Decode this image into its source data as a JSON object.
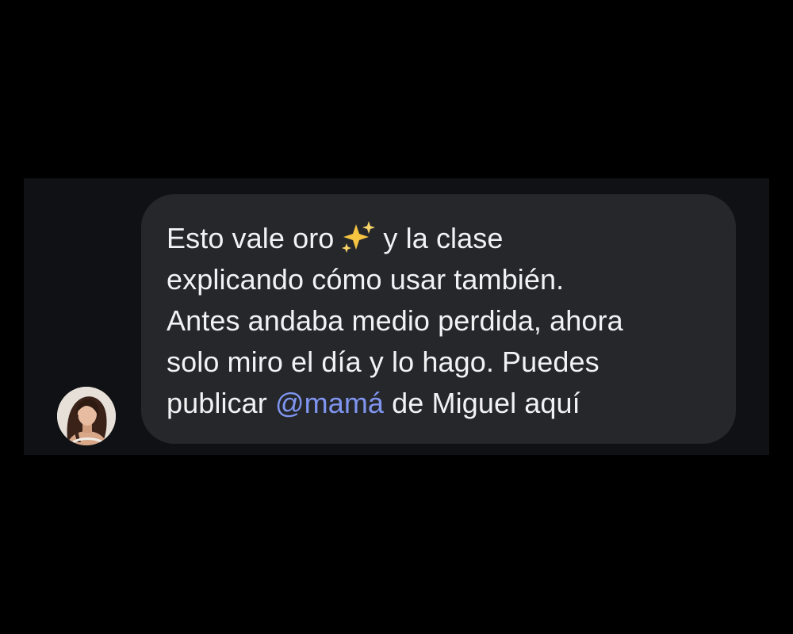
{
  "conversation": {
    "message": {
      "line1_before": "Esto vale oro",
      "emoji": "sparkles-icon",
      "line1_after": "y la clase",
      "line2": "explicando cómo usar también.",
      "line3": "Antes andaba medio perdida, ahora",
      "line4": "solo miro el día y lo hago. Puedes",
      "line5_before": "publicar",
      "mention": "@mamá",
      "line5_after": "de Miguel aquí"
    },
    "colors": {
      "background": "#000000",
      "strip": "#0f1114",
      "bubble": "#25272b",
      "text": "#f2f2f4",
      "mention": "#7f95f0",
      "sparkles": "#f5c542"
    }
  }
}
